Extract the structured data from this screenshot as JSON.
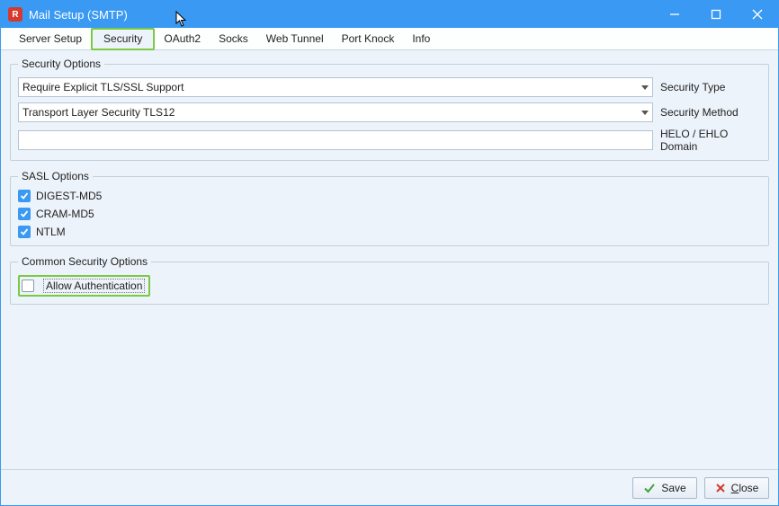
{
  "window": {
    "title": "Mail Setup (SMTP)"
  },
  "tabs": [
    {
      "label": "Server Setup",
      "active": false
    },
    {
      "label": "Security",
      "active": true
    },
    {
      "label": "OAuth2",
      "active": false
    },
    {
      "label": "Socks",
      "active": false
    },
    {
      "label": "Web Tunnel",
      "active": false
    },
    {
      "label": "Port Knock",
      "active": false
    },
    {
      "label": "Info",
      "active": false
    }
  ],
  "security_options": {
    "legend": "Security Options",
    "security_type": {
      "value": "Require Explicit TLS/SSL Support",
      "label": "Security Type"
    },
    "security_method": {
      "value": "Transport Layer Security TLS12",
      "label": "Security Method"
    },
    "helo_domain": {
      "value": "",
      "label": "HELO / EHLO Domain"
    }
  },
  "sasl_options": {
    "legend": "SASL Options",
    "items": [
      {
        "label": "DIGEST-MD5",
        "checked": true
      },
      {
        "label": "CRAM-MD5",
        "checked": true
      },
      {
        "label": "NTLM",
        "checked": true
      }
    ]
  },
  "common_security": {
    "legend": "Common Security Options",
    "allow_auth": {
      "label": "Allow Authentication",
      "checked": false
    }
  },
  "footer": {
    "save": "Save",
    "close": "Close"
  }
}
